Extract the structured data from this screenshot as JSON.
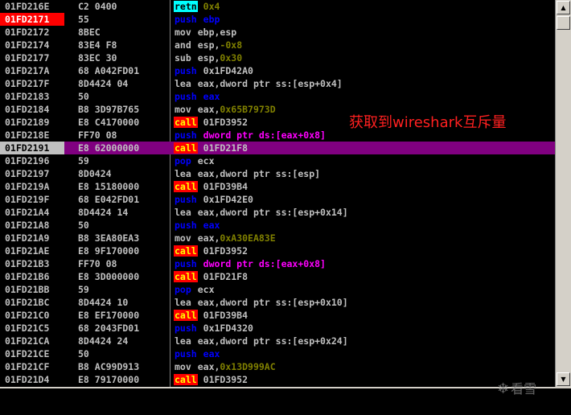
{
  "annotation": "获取到wireshark互斥量",
  "watermark": {
    "icon": "snowflake-icon",
    "text": "看雪"
  },
  "rows": [
    {
      "addr": "01FD216E",
      "hex": "C2 0400",
      "mnem": "retn",
      "mtype": "retn",
      "ops": [
        {
          "t": "0x4",
          "c": "imm"
        }
      ]
    },
    {
      "addr": "01FD2171",
      "hex": "55",
      "mnem": "push",
      "mtype": "push",
      "ops": [
        {
          "t": "ebp",
          "c": "push"
        }
      ],
      "flag": "bp"
    },
    {
      "addr": "01FD2172",
      "hex": "8BEC",
      "mnem": "mov",
      "mtype": "plain",
      "ops": [
        {
          "t": "ebp,esp",
          "c": "c"
        }
      ]
    },
    {
      "addr": "01FD2174",
      "hex": "83E4 F8",
      "mnem": "and",
      "mtype": "plain",
      "ops": [
        {
          "t": "esp,",
          "c": "c"
        },
        {
          "t": "-0x8",
          "c": "imm"
        }
      ]
    },
    {
      "addr": "01FD2177",
      "hex": "83EC 30",
      "mnem": "sub",
      "mtype": "plain",
      "ops": [
        {
          "t": "esp,",
          "c": "c"
        },
        {
          "t": "0x30",
          "c": "imm"
        }
      ]
    },
    {
      "addr": "01FD217A",
      "hex": "68 A042FD01",
      "mnem": "push",
      "mtype": "push",
      "ops": [
        {
          "t": "0x1FD42A0",
          "c": "c"
        }
      ]
    },
    {
      "addr": "01FD217F",
      "hex": "8D4424 04",
      "mnem": "lea",
      "mtype": "plain",
      "ops": [
        {
          "t": "eax,dword ptr ss:[esp+0x4]",
          "c": "c"
        }
      ]
    },
    {
      "addr": "01FD2183",
      "hex": "50",
      "mnem": "push",
      "mtype": "push",
      "ops": [
        {
          "t": "eax",
          "c": "push"
        }
      ]
    },
    {
      "addr": "01FD2184",
      "hex": "B8 3D97B765",
      "mnem": "mov",
      "mtype": "plain",
      "ops": [
        {
          "t": "eax,",
          "c": "c"
        },
        {
          "t": "0x65B7973D",
          "c": "imm"
        }
      ]
    },
    {
      "addr": "01FD2189",
      "hex": "E8 C4170000",
      "mnem": "call",
      "mtype": "call",
      "ops": [
        {
          "t": "01FD3952",
          "c": "c"
        }
      ]
    },
    {
      "addr": "01FD218E",
      "hex": "FF70 08",
      "mnem": "push",
      "mtype": "push",
      "ops": [
        {
          "t": "dword ptr ds:[eax+0x8]",
          "c": "ds"
        }
      ]
    },
    {
      "addr": "01FD2191",
      "hex": "E8 62000000",
      "mnem": "call",
      "mtype": "call",
      "ops": [
        {
          "t": "01FD21F8",
          "c": "c"
        }
      ],
      "flag": "sel"
    },
    {
      "addr": "01FD2196",
      "hex": "59",
      "mnem": "pop",
      "mtype": "push",
      "ops": [
        {
          "t": "ecx",
          "c": "c"
        }
      ]
    },
    {
      "addr": "01FD2197",
      "hex": "8D0424",
      "mnem": "lea",
      "mtype": "plain",
      "ops": [
        {
          "t": "eax,dword ptr ss:[esp]",
          "c": "c"
        }
      ]
    },
    {
      "addr": "01FD219A",
      "hex": "E8 15180000",
      "mnem": "call",
      "mtype": "call",
      "ops": [
        {
          "t": "01FD39B4",
          "c": "c"
        }
      ]
    },
    {
      "addr": "01FD219F",
      "hex": "68 E042FD01",
      "mnem": "push",
      "mtype": "push",
      "ops": [
        {
          "t": "0x1FD42E0",
          "c": "c"
        }
      ]
    },
    {
      "addr": "01FD21A4",
      "hex": "8D4424 14",
      "mnem": "lea",
      "mtype": "plain",
      "ops": [
        {
          "t": "eax,dword ptr ss:[esp+0x14]",
          "c": "c"
        }
      ]
    },
    {
      "addr": "01FD21A8",
      "hex": "50",
      "mnem": "push",
      "mtype": "push",
      "ops": [
        {
          "t": "eax",
          "c": "push"
        }
      ]
    },
    {
      "addr": "01FD21A9",
      "hex": "B8 3EA80EA3",
      "mnem": "mov",
      "mtype": "plain",
      "ops": [
        {
          "t": "eax,",
          "c": "c"
        },
        {
          "t": "0xA30EA83E",
          "c": "imm"
        }
      ]
    },
    {
      "addr": "01FD21AE",
      "hex": "E8 9F170000",
      "mnem": "call",
      "mtype": "call",
      "ops": [
        {
          "t": "01FD3952",
          "c": "c"
        }
      ]
    },
    {
      "addr": "01FD21B3",
      "hex": "FF70 08",
      "mnem": "push",
      "mtype": "push",
      "ops": [
        {
          "t": "dword ptr ds:[eax+0x8]",
          "c": "ds"
        }
      ]
    },
    {
      "addr": "01FD21B6",
      "hex": "E8 3D000000",
      "mnem": "call",
      "mtype": "call",
      "ops": [
        {
          "t": "01FD21F8",
          "c": "c"
        }
      ]
    },
    {
      "addr": "01FD21BB",
      "hex": "59",
      "mnem": "pop",
      "mtype": "push",
      "ops": [
        {
          "t": "ecx",
          "c": "c"
        }
      ]
    },
    {
      "addr": "01FD21BC",
      "hex": "8D4424 10",
      "mnem": "lea",
      "mtype": "plain",
      "ops": [
        {
          "t": "eax,dword ptr ss:[esp+0x10]",
          "c": "c"
        }
      ]
    },
    {
      "addr": "01FD21C0",
      "hex": "E8 EF170000",
      "mnem": "call",
      "mtype": "call",
      "ops": [
        {
          "t": "01FD39B4",
          "c": "c"
        }
      ]
    },
    {
      "addr": "01FD21C5",
      "hex": "68 2043FD01",
      "mnem": "push",
      "mtype": "push",
      "ops": [
        {
          "t": "0x1FD4320",
          "c": "c"
        }
      ]
    },
    {
      "addr": "01FD21CA",
      "hex": "8D4424 24",
      "mnem": "lea",
      "mtype": "plain",
      "ops": [
        {
          "t": "eax,dword ptr ss:[esp+0x24]",
          "c": "c"
        }
      ]
    },
    {
      "addr": "01FD21CE",
      "hex": "50",
      "mnem": "push",
      "mtype": "push",
      "ops": [
        {
          "t": "eax",
          "c": "push"
        }
      ]
    },
    {
      "addr": "01FD21CF",
      "hex": "B8 AC99D913",
      "mnem": "mov",
      "mtype": "plain",
      "ops": [
        {
          "t": "eax,",
          "c": "c"
        },
        {
          "t": "0x13D999AC",
          "c": "imm"
        }
      ]
    },
    {
      "addr": "01FD21D4",
      "hex": "E8 79170000",
      "mnem": "call",
      "mtype": "call",
      "ops": [
        {
          "t": "01FD3952",
          "c": "c"
        }
      ]
    }
  ],
  "scrollbar": {
    "up_icon": "arrow-up-icon",
    "down_icon": "arrow-down-icon",
    "up": "▲",
    "down": "▼"
  }
}
